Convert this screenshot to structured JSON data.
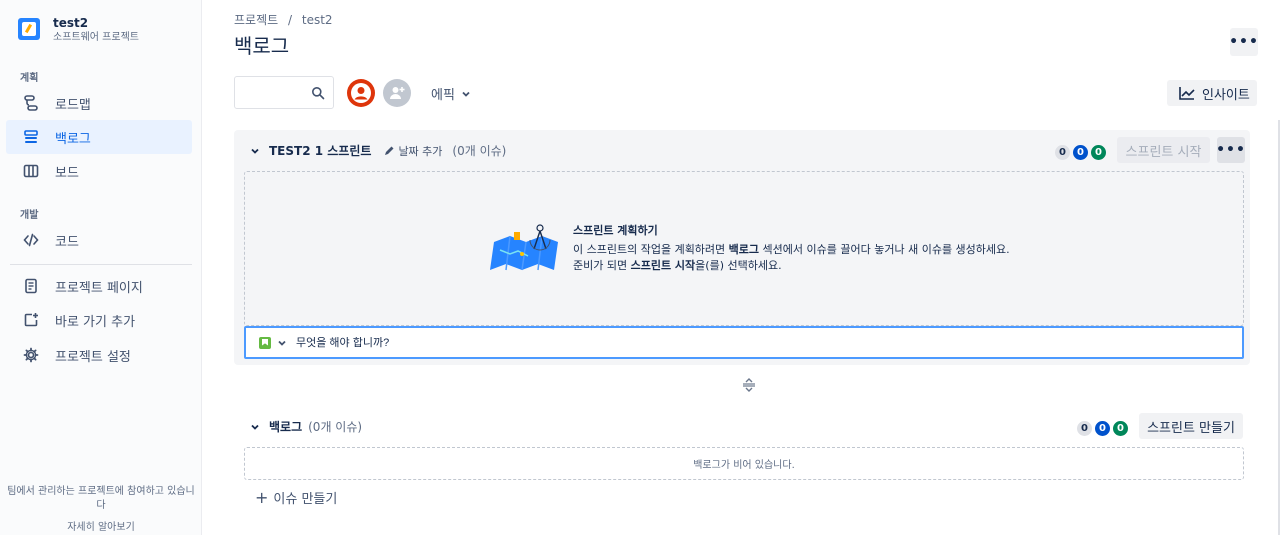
{
  "sidebar": {
    "project_name": "test2",
    "project_type": "소프트웨어 프로젝트",
    "section_plan": "계획",
    "section_dev": "개발",
    "items": [
      {
        "label": "로드맵",
        "icon": "roadmap-icon"
      },
      {
        "label": "백로그",
        "icon": "backlog-icon"
      },
      {
        "label": "보드",
        "icon": "board-icon"
      },
      {
        "label": "코드",
        "icon": "code-icon"
      },
      {
        "label": "프로젝트 페이지",
        "icon": "page-icon"
      },
      {
        "label": "바로 가기 추가",
        "icon": "add-shortcut-icon"
      },
      {
        "label": "프로젝트 설정",
        "icon": "gear-icon"
      }
    ],
    "footer_text": "팀에서 관리하는 프로젝트에 참여하고 있습니다",
    "footer_link": "자세히 알아보기"
  },
  "header": {
    "breadcrumb": [
      "프로젝트",
      "test2"
    ],
    "breadcrumb_sep": "/",
    "title": "백로그"
  },
  "toolbar": {
    "search_placeholder": "",
    "epic_label": "에픽",
    "insight_label": "인사이트"
  },
  "sprint": {
    "name": "TEST2 1 스프린트",
    "add_date": "날짜 추가",
    "issue_count": "(0개 이슈)",
    "badges": [
      "0",
      "0",
      "0"
    ],
    "start_label": "스프린트 시작",
    "plan_title": "스프린트 계획하기",
    "plan_desc_1": "이 스프린트의 작업을 계획하려면 ",
    "plan_desc_bold1": "백로그",
    "plan_desc_2": " 섹션에서 이슈를 끌어다 놓거나 새 이슈를 생성하세요. 준비가 되면 ",
    "plan_desc_bold2": "스프린트 시작",
    "plan_desc_3": "을(를) 선택하세요.",
    "create_placeholder": "무엇을 해야 합니까?"
  },
  "backlog": {
    "name": "백로그",
    "issue_count": "(0개 이슈)",
    "badges": [
      "0",
      "0",
      "0"
    ],
    "create_sprint_label": "스프린트 만들기",
    "empty_text": "백로그가 비어 있습니다.",
    "create_issue_label": "이슈 만들기"
  },
  "colors": {
    "accent": "#0c66e4",
    "badge_blue": "#0052cc",
    "badge_green": "#00875a",
    "story_green": "#65ba43",
    "avatar_red": "#de350b"
  }
}
